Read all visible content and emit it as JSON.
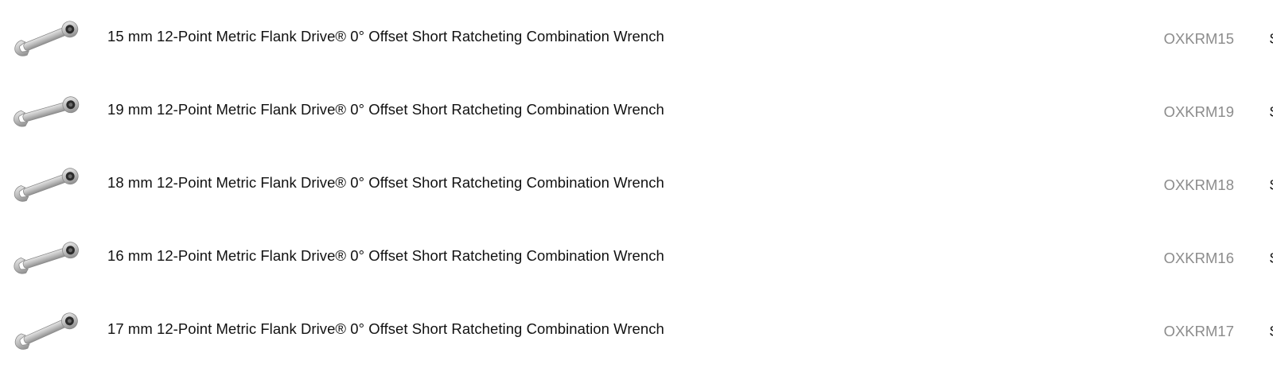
{
  "products": [
    {
      "thumbnail_icon": "ratcheting-combination-wrench",
      "title": "15 mm 12-Point Metric Flank Drive® 0° Offset Short Ratcheting Combination Wrench",
      "sku": "OXKRM15"
    },
    {
      "thumbnail_icon": "ratcheting-combination-wrench",
      "title": "19 mm 12-Point Metric Flank Drive® 0° Offset Short Ratcheting Combination Wrench",
      "sku": "OXKRM19"
    },
    {
      "thumbnail_icon": "ratcheting-combination-wrench",
      "title": "18 mm 12-Point Metric Flank Drive® 0° Offset Short Ratcheting Combination Wrench",
      "sku": "OXKRM18"
    },
    {
      "thumbnail_icon": "ratcheting-combination-wrench",
      "title": "16 mm 12-Point Metric Flank Drive® 0° Offset Short Ratcheting Combination Wrench",
      "sku": "OXKRM16"
    },
    {
      "thumbnail_icon": "ratcheting-combination-wrench",
      "title": "17 mm 12-Point Metric Flank Drive® 0° Offset Short Ratcheting Combination Wrench",
      "sku": "OXKRM17"
    }
  ],
  "colors": {
    "title_text": "#111111",
    "sku_text": "#8c8c8c",
    "background": "#ffffff"
  }
}
